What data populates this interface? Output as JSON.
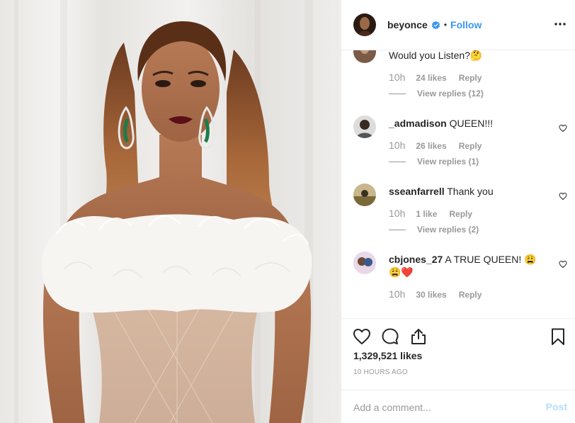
{
  "post": {
    "image_alt": "Woman in white feathered off-shoulder gown with green drop earrings",
    "likes": "1,329,521 likes",
    "time_ago": "10 HOURS AGO"
  },
  "header": {
    "username": "beyonce",
    "separator": "•",
    "follow_label": "Follow",
    "verified_icon": "verified-badge-icon",
    "more_icon": "more-options-icon"
  },
  "comments": [
    {
      "username": "",
      "text": "Would you Listen?🤔",
      "time": "10h",
      "likes": "24 likes",
      "reply": "Reply",
      "view_replies": "View replies (12)"
    },
    {
      "username": "_admadison",
      "text": "QUEEN!!!",
      "time": "10h",
      "likes": "26 likes",
      "reply": "Reply",
      "view_replies": "View replies (1)"
    },
    {
      "username": "sseanfarrell",
      "text": "Thank you",
      "time": "10h",
      "likes": "1 like",
      "reply": "Reply",
      "view_replies": "View replies (2)"
    },
    {
      "username": "cbjones_27",
      "text": "A TRUE QUEEN! 😩😩❤️",
      "time": "10h",
      "likes": "30 likes",
      "reply": "Reply",
      "view_replies": ""
    }
  ],
  "actions": {
    "like_icon": "heart-icon",
    "comment_icon": "comment-icon",
    "share_icon": "share-icon",
    "save_icon": "bookmark-icon"
  },
  "add_comment": {
    "placeholder": "Add a comment...",
    "post_label": "Post"
  },
  "colors": {
    "link_blue": "#3897f0",
    "muted_gray": "#999999",
    "post_disabled": "#b2dffc",
    "verified_blue": "#3897f0"
  }
}
